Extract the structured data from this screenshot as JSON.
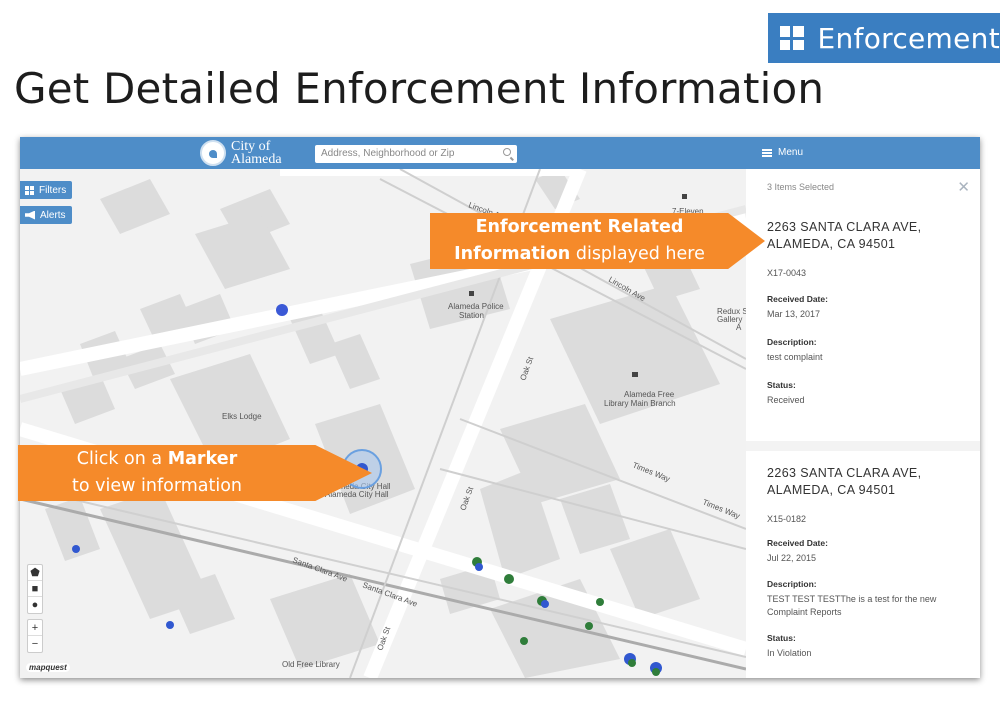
{
  "badge": {
    "label": "Enforcement",
    "icon": "grid-icon"
  },
  "slide_title": "Get Detailed Enforcement Information",
  "app": {
    "logo_line1": "City of",
    "logo_line2": "Alameda",
    "search_placeholder": "Address, Neighborhood or Zip",
    "menu_label": "Menu",
    "accent_color": "#4e8dc8"
  },
  "map": {
    "filters_label": "Filters",
    "alerts_label": "Alerts",
    "zoom_in": "+",
    "zoom_out": "−",
    "attribution": "mapquest",
    "labels": {
      "lincoln_ave_1": "Lincoln Ave",
      "lincoln_ave_2": "Lincoln Ave",
      "seven_eleven": "7-Eleven",
      "police_1": "Alameda Police",
      "police_2": "Station",
      "library_1": "Alameda Free",
      "library_2": "Library Main Branch",
      "elks": "Elks Lodge",
      "city_hall_1": "Alameda City Hall",
      "city_hall_2": "Alameda City Hall",
      "oak_st_1": "Oak St",
      "oak_st_2": "Oak St",
      "oak_st_3": "Oak St",
      "santa_clara_1": "Santa Clara Ave",
      "santa_clara_2": "Santa Clara Ave",
      "times_way_1": "Times Way",
      "times_way_2": "Times Way",
      "old_free_library": "Old Free Library",
      "redux_1": "Redux S",
      "redux_2": "Gallery",
      "redux_3": "A"
    }
  },
  "panel": {
    "header": "3 Items Selected",
    "close_icon": "close-icon",
    "items": [
      {
        "address_line1": "2263 SANTA CLARA AVE,",
        "address_line2": "ALAMEDA, CA 94501",
        "case_id": "X17-0043",
        "received_label": "Received Date:",
        "received_value": "Mar 13, 2017",
        "description_label": "Description:",
        "description_value": "test complaint",
        "status_label": "Status:",
        "status_value": "Received"
      },
      {
        "address_line1": "2263 SANTA CLARA AVE,",
        "address_line2": "ALAMEDA, CA 94501",
        "case_id": "X15-0182",
        "received_label": "Received Date:",
        "received_value": "Jul 22, 2015",
        "description_label": "Description:",
        "description_value": "TEST TEST TESTThe is a test for the new Complaint Reports",
        "status_label": "Status:",
        "status_value": "In Violation"
      }
    ]
  },
  "callouts": {
    "top_bold1": "Enforcement Related",
    "top_bold2": "Information",
    "top_rest": " displayed here",
    "left_pre": "Click on a ",
    "left_bold": "Marker",
    "left_line2": "to view information",
    "color": "#f58a2a"
  }
}
